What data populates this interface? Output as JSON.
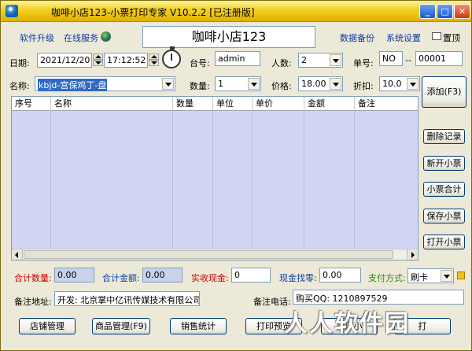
{
  "window": {
    "title": "咖啡小店123-小票打印专家 V10.2.2 [已注册版]",
    "min_label": "_",
    "max_label": "□",
    "close_label": "✕"
  },
  "topbar": {
    "upgrade": "软件升级",
    "online_service": "在线服务",
    "shop_name": "咖啡小店123",
    "backup": "数据备份",
    "settings": "系统设置",
    "pin_top": "置顶"
  },
  "form": {
    "date_label": "日期:",
    "date_value": "2021/12/20",
    "time_value": "17:12:52",
    "table_label": "台号:",
    "table_value": "admin",
    "people_label": "人数:",
    "people_value": "2",
    "order_label": "单号:",
    "order_prefix": "NO",
    "order_sep": "--",
    "order_number": "00001",
    "name_label": "名称:",
    "name_value": "kbjd-宫保鸡丁-盘",
    "qty_label": "数量:",
    "qty_value": "1",
    "price_label": "价格:",
    "price_value": "18.00",
    "discount_label": "折扣:",
    "discount_value": "10.0"
  },
  "grid": {
    "columns": [
      "序号",
      "名称",
      "数量",
      "单位",
      "单价",
      "金额",
      "备注"
    ]
  },
  "side_buttons": {
    "add": "添加(F3)",
    "delete": "删除记录",
    "new": "新开小票",
    "total": "小票合计",
    "save": "保存小票",
    "open": "打开小票"
  },
  "summary": {
    "total_qty_label": "合计数量:",
    "total_qty_value": "0.00",
    "total_amount_label": "合计金额:",
    "total_amount_value": "0.00",
    "cash_received_label": "实收现金:",
    "cash_received_value": "0",
    "change_label": "现金找零:",
    "change_value": "0.00",
    "payment_label": "支付方式:",
    "payment_value": "刷卡"
  },
  "footer_info": {
    "address_label": "备注地址:",
    "address_value": "开发: 北京掌中亿讯传媒技术有限公司",
    "phone_label": "备注电话:",
    "phone_value": "购买QQ: 1210897529"
  },
  "bottom_buttons": {
    "shop_manage": "店铺管理",
    "goods_manage": "商品管理(F9)",
    "sales_stats": "销售统计",
    "print_preview": "打印预览",
    "print_small": "打印小",
    "other": "打"
  },
  "watermark": "人人软件园",
  "colors": {
    "titlebar": "#f3d020",
    "window_bg": "#ece9d8",
    "grid_bg": "#d2d6f4",
    "red_label": "#c80000",
    "blue_label": "#0a3aa8",
    "green_label": "#2a8a10"
  }
}
